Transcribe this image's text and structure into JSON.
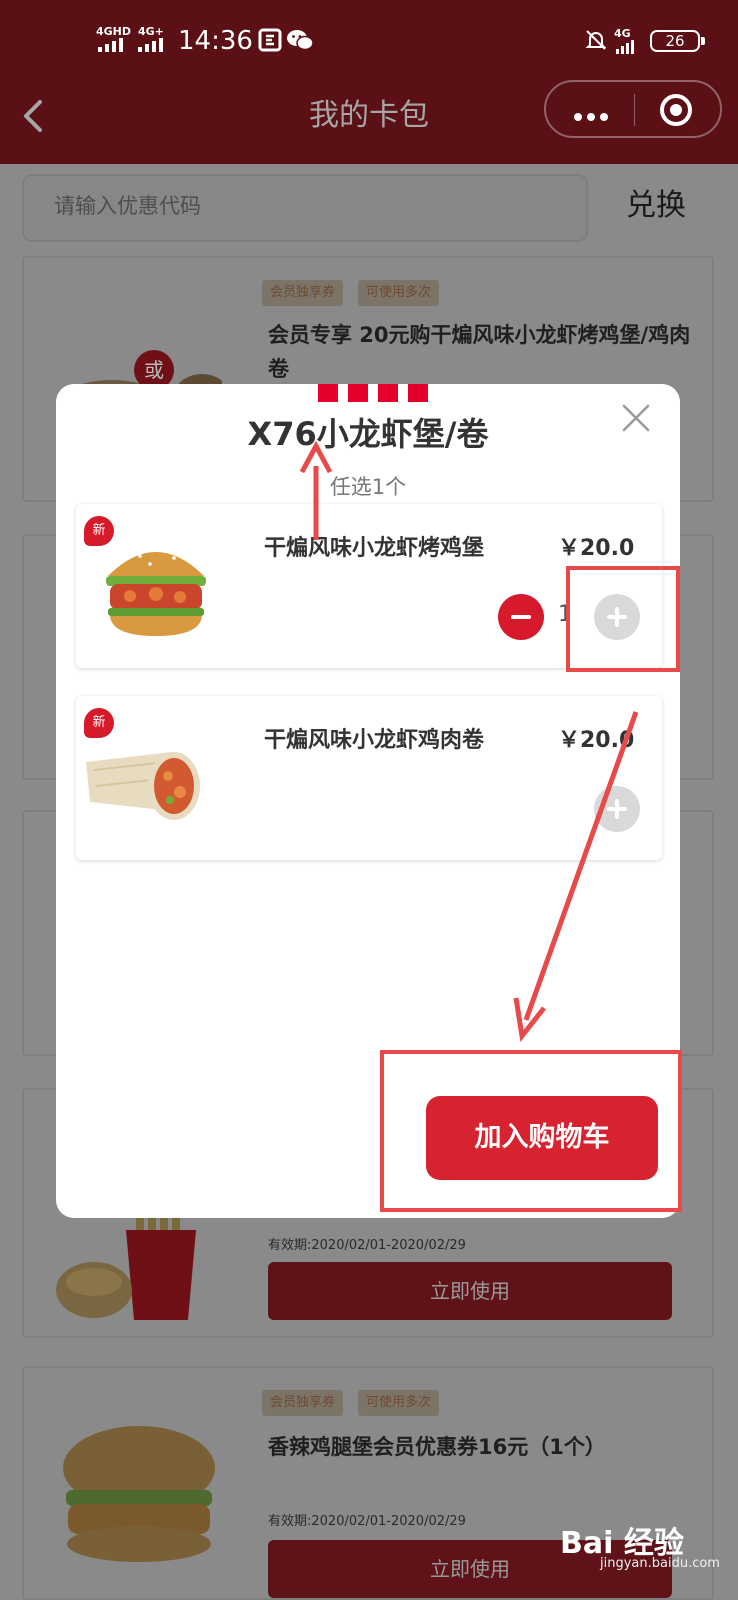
{
  "status_bar": {
    "network_1": "4GHD",
    "network_2": "4G+",
    "time": "14:36",
    "network_3": "4G",
    "battery": "26"
  },
  "nav": {
    "title": "我的卡包"
  },
  "redeem": {
    "placeholder": "请输入优惠代码",
    "button_label": "兑换"
  },
  "coupons": [
    {
      "tags": [
        "会员独享券",
        "可使用多次"
      ],
      "title": "会员专享 20元购干煸风味小龙虾烤鸡堡/鸡肉卷",
      "badge": "或"
    },
    {
      "validity": "有效期:2020/02/01-2020/02/29",
      "use_label": "立即使用"
    },
    {
      "tags": [
        "会员独享券",
        "可使用多次"
      ],
      "title": "香辣鸡腿堡会员优惠券16元（1个）",
      "validity": "有效期:2020/02/01-2020/02/29",
      "use_label": "立即使用"
    }
  ],
  "modal": {
    "title": "X76小龙虾堡/卷",
    "subtitle": "任选1个",
    "items": [
      {
        "badge": "新",
        "name": "干煸风味小龙虾烤鸡堡",
        "price": "￥20.0",
        "quantity": "1"
      },
      {
        "badge": "新",
        "name": "干煸风味小龙虾鸡肉卷",
        "price": "￥20.0"
      }
    ],
    "add_to_cart": "加入购物车"
  },
  "watermark": {
    "brand": "Bai  经验",
    "site": "jingyan.baidu.com"
  },
  "colors": {
    "kfc_red": "#e4002b",
    "button_red": "#d7222f",
    "annotation_red": "#e84a4a",
    "nav_bar": "#5a1015"
  }
}
